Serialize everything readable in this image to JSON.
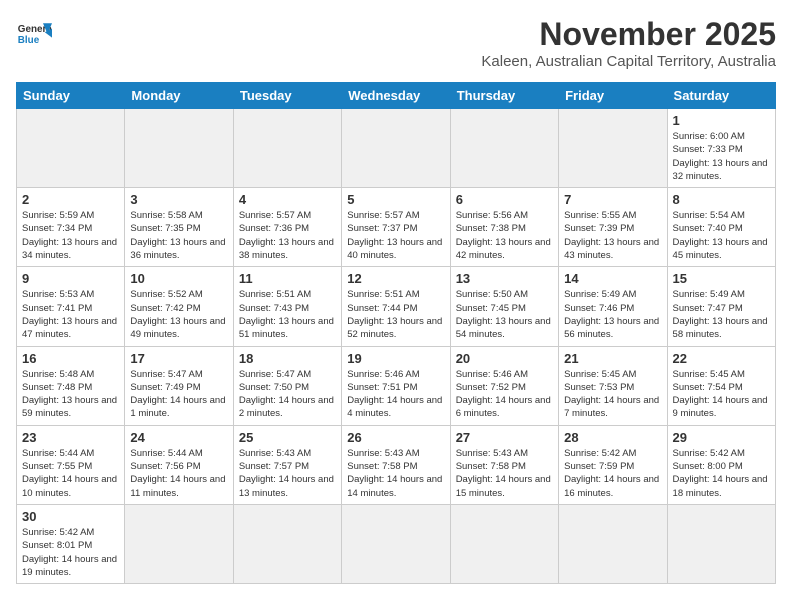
{
  "logo": {
    "line1": "General",
    "line2": "Blue"
  },
  "title": "November 2025",
  "location": "Kaleen, Australian Capital Territory, Australia",
  "days_of_week": [
    "Sunday",
    "Monday",
    "Tuesday",
    "Wednesday",
    "Thursday",
    "Friday",
    "Saturday"
  ],
  "weeks": [
    [
      {
        "day": "",
        "empty": true
      },
      {
        "day": "",
        "empty": true
      },
      {
        "day": "",
        "empty": true
      },
      {
        "day": "",
        "empty": true
      },
      {
        "day": "",
        "empty": true
      },
      {
        "day": "",
        "empty": true
      },
      {
        "day": "1",
        "sunrise": "6:00 AM",
        "sunset": "7:33 PM",
        "daylight": "13 hours and 32 minutes."
      }
    ],
    [
      {
        "day": "2",
        "sunrise": "5:59 AM",
        "sunset": "7:34 PM",
        "daylight": "13 hours and 34 minutes."
      },
      {
        "day": "3",
        "sunrise": "5:58 AM",
        "sunset": "7:35 PM",
        "daylight": "13 hours and 36 minutes."
      },
      {
        "day": "4",
        "sunrise": "5:57 AM",
        "sunset": "7:36 PM",
        "daylight": "13 hours and 38 minutes."
      },
      {
        "day": "5",
        "sunrise": "5:57 AM",
        "sunset": "7:37 PM",
        "daylight": "13 hours and 40 minutes."
      },
      {
        "day": "6",
        "sunrise": "5:56 AM",
        "sunset": "7:38 PM",
        "daylight": "13 hours and 42 minutes."
      },
      {
        "day": "7",
        "sunrise": "5:55 AM",
        "sunset": "7:39 PM",
        "daylight": "13 hours and 43 minutes."
      },
      {
        "day": "8",
        "sunrise": "5:54 AM",
        "sunset": "7:40 PM",
        "daylight": "13 hours and 45 minutes."
      }
    ],
    [
      {
        "day": "9",
        "sunrise": "5:53 AM",
        "sunset": "7:41 PM",
        "daylight": "13 hours and 47 minutes."
      },
      {
        "day": "10",
        "sunrise": "5:52 AM",
        "sunset": "7:42 PM",
        "daylight": "13 hours and 49 minutes."
      },
      {
        "day": "11",
        "sunrise": "5:51 AM",
        "sunset": "7:43 PM",
        "daylight": "13 hours and 51 minutes."
      },
      {
        "day": "12",
        "sunrise": "5:51 AM",
        "sunset": "7:44 PM",
        "daylight": "13 hours and 52 minutes."
      },
      {
        "day": "13",
        "sunrise": "5:50 AM",
        "sunset": "7:45 PM",
        "daylight": "13 hours and 54 minutes."
      },
      {
        "day": "14",
        "sunrise": "5:49 AM",
        "sunset": "7:46 PM",
        "daylight": "13 hours and 56 minutes."
      },
      {
        "day": "15",
        "sunrise": "5:49 AM",
        "sunset": "7:47 PM",
        "daylight": "13 hours and 58 minutes."
      }
    ],
    [
      {
        "day": "16",
        "sunrise": "5:48 AM",
        "sunset": "7:48 PM",
        "daylight": "13 hours and 59 minutes."
      },
      {
        "day": "17",
        "sunrise": "5:47 AM",
        "sunset": "7:49 PM",
        "daylight": "14 hours and 1 minute."
      },
      {
        "day": "18",
        "sunrise": "5:47 AM",
        "sunset": "7:50 PM",
        "daylight": "14 hours and 2 minutes."
      },
      {
        "day": "19",
        "sunrise": "5:46 AM",
        "sunset": "7:51 PM",
        "daylight": "14 hours and 4 minutes."
      },
      {
        "day": "20",
        "sunrise": "5:46 AM",
        "sunset": "7:52 PM",
        "daylight": "14 hours and 6 minutes."
      },
      {
        "day": "21",
        "sunrise": "5:45 AM",
        "sunset": "7:53 PM",
        "daylight": "14 hours and 7 minutes."
      },
      {
        "day": "22",
        "sunrise": "5:45 AM",
        "sunset": "7:54 PM",
        "daylight": "14 hours and 9 minutes."
      }
    ],
    [
      {
        "day": "23",
        "sunrise": "5:44 AM",
        "sunset": "7:55 PM",
        "daylight": "14 hours and 10 minutes."
      },
      {
        "day": "24",
        "sunrise": "5:44 AM",
        "sunset": "7:56 PM",
        "daylight": "14 hours and 11 minutes."
      },
      {
        "day": "25",
        "sunrise": "5:43 AM",
        "sunset": "7:57 PM",
        "daylight": "14 hours and 13 minutes."
      },
      {
        "day": "26",
        "sunrise": "5:43 AM",
        "sunset": "7:58 PM",
        "daylight": "14 hours and 14 minutes."
      },
      {
        "day": "27",
        "sunrise": "5:43 AM",
        "sunset": "7:58 PM",
        "daylight": "14 hours and 15 minutes."
      },
      {
        "day": "28",
        "sunrise": "5:42 AM",
        "sunset": "7:59 PM",
        "daylight": "14 hours and 16 minutes."
      },
      {
        "day": "29",
        "sunrise": "5:42 AM",
        "sunset": "8:00 PM",
        "daylight": "14 hours and 18 minutes."
      }
    ],
    [
      {
        "day": "30",
        "sunrise": "5:42 AM",
        "sunset": "8:01 PM",
        "daylight": "14 hours and 19 minutes."
      },
      {
        "day": "",
        "empty": true
      },
      {
        "day": "",
        "empty": true
      },
      {
        "day": "",
        "empty": true
      },
      {
        "day": "",
        "empty": true
      },
      {
        "day": "",
        "empty": true
      },
      {
        "day": "",
        "empty": true
      }
    ]
  ]
}
